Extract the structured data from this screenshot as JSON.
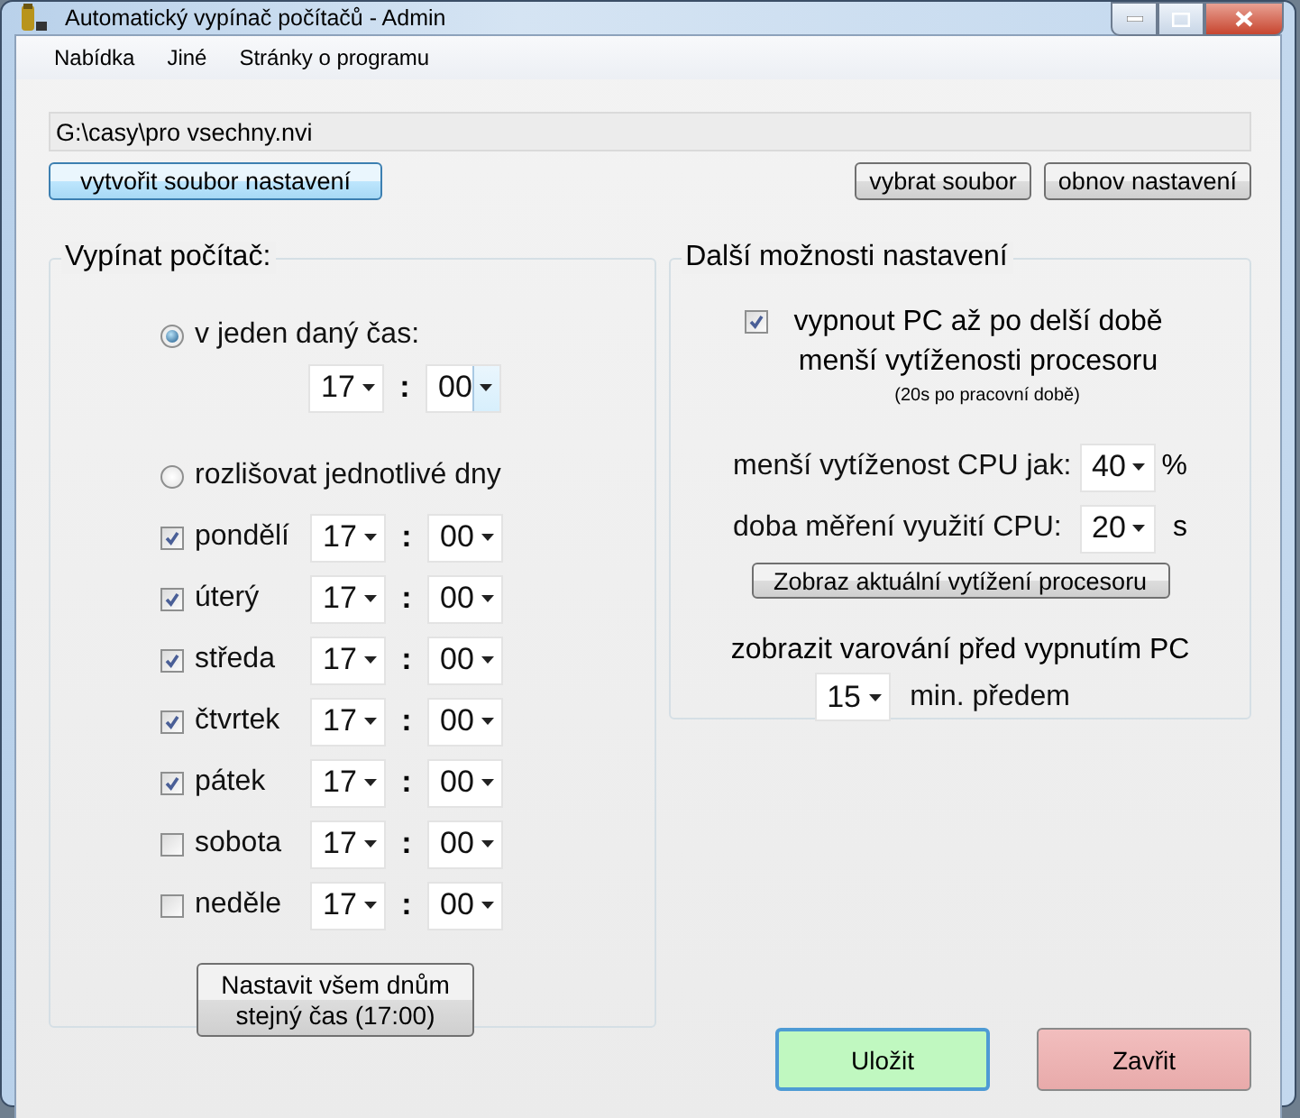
{
  "window": {
    "title": "Automatický vypínač počítačů - Admin"
  },
  "menu": [
    "Nabídka",
    "Jiné",
    "Stránky o programu"
  ],
  "file_path": "G:\\casy\\pro vsechny.nvi",
  "file_buttons": [
    {
      "label": "vytvořit soubor nastavení",
      "highlighted": true
    },
    {
      "label": "vybrat soubor",
      "highlighted": false
    },
    {
      "label": "obnov nastavení",
      "highlighted": false
    }
  ],
  "shutdown": {
    "title": "Vypínat počítač:",
    "modes": [
      {
        "label": "v jeden daný čas:",
        "selected": true
      },
      {
        "label": "rozlišovat jednotlivé dny",
        "selected": false
      }
    ],
    "single_time": {
      "hour": "17",
      "separator": ":",
      "minute": "00",
      "minute_highlighted": true
    },
    "days": [
      {
        "label": "pondělí",
        "checked": true,
        "hour": "17",
        "separator": ":",
        "minute": "00"
      },
      {
        "label": "úterý",
        "checked": true,
        "hour": "17",
        "separator": ":",
        "minute": "00"
      },
      {
        "label": "středa",
        "checked": true,
        "hour": "17",
        "separator": ":",
        "minute": "00"
      },
      {
        "label": "čtvrtek",
        "checked": true,
        "hour": "17",
        "separator": ":",
        "minute": "00"
      },
      {
        "label": "pátek",
        "checked": true,
        "hour": "17",
        "separator": ":",
        "minute": "00"
      },
      {
        "label": "sobota",
        "checked": false,
        "hour": "17",
        "separator": ":",
        "minute": "00"
      },
      {
        "label": "neděle",
        "checked": false,
        "hour": "17",
        "separator": ":",
        "minute": "00"
      }
    ],
    "apply_all_button": "Nastavit všem dnům stejný čas (17:00)"
  },
  "more_options": {
    "title": "Další možnosti nastavení",
    "idle_shutdown": {
      "label": "vypnout PC až po delší době menší vytíženosti procesoru",
      "checked": true,
      "note": "(20s po pracovní době)"
    },
    "cpu_threshold": {
      "label": "menší vytíženost CPU jak:",
      "value": "40",
      "unit": "%"
    },
    "measure_time": {
      "label": "doba měření využití CPU:",
      "value": "20",
      "unit": "s"
    },
    "show_cpu_button": "Zobraz aktuální vytížení procesoru",
    "warning": {
      "label": "zobrazit varování před vypnutím PC",
      "value": "15",
      "unit": "min. předem"
    }
  },
  "buttons": [
    {
      "kind": "save",
      "label": "Uložit"
    },
    {
      "kind": "close",
      "label": "Zavřit"
    }
  ]
}
